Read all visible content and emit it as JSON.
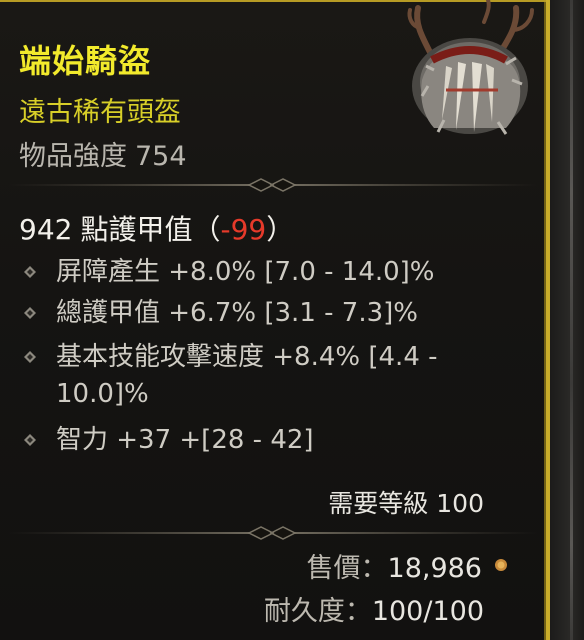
{
  "item": {
    "name": "端始騎盜",
    "type": "遠古稀有頭盔",
    "power_label": "物品強度",
    "power_value": "754"
  },
  "armor": {
    "value": "942",
    "label": "點護甲值",
    "open_paren": "（",
    "delta": "-99",
    "close_paren": "）"
  },
  "affixes": [
    {
      "text": "屏障產生 +8.0% [7.0 - 14.0]%"
    },
    {
      "text": "總護甲值 +6.7% [3.1 - 7.3]%"
    },
    {
      "text": "基本技能攻擊速度 +8.4% [4.4 - 10.0]%"
    },
    {
      "text": "智力 +37 +[28 - 42]"
    }
  ],
  "requirement": {
    "label": "需要等級",
    "value": "100"
  },
  "sell": {
    "label": "售價：",
    "value": "18,986",
    "icon": "gold-coin-icon"
  },
  "durability": {
    "label": "耐久度：",
    "value": "100/100"
  },
  "colors": {
    "rare_name": "#f2ea2c",
    "rare_type": "#d8cf28",
    "negative": "#e63a2a",
    "frame_gold": "#c9ad2a"
  }
}
